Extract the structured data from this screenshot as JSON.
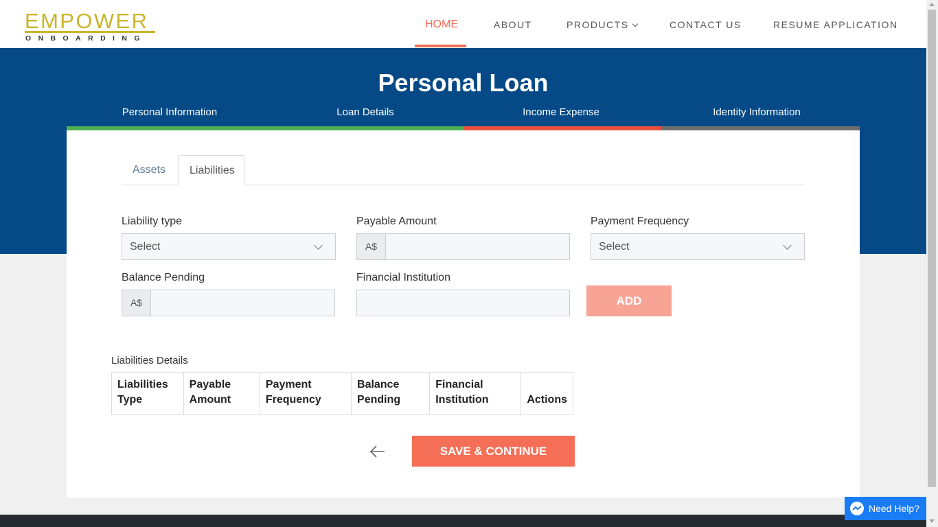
{
  "header": {
    "logo_main": "EMPOWER",
    "logo_sub": "ONBOARDING",
    "nav": [
      "HOME",
      "ABOUT",
      "PRODUCTS",
      "CONTACT US",
      "RESUME APPLICATION"
    ],
    "active_nav": "HOME"
  },
  "page": {
    "title": "Personal Loan",
    "steps": [
      "Personal Information",
      "Loan Details",
      "Income Expense",
      "Identity Information"
    ]
  },
  "tabs": {
    "assets": "Assets",
    "liabilities": "Liabilities",
    "active": "Liabilities"
  },
  "form": {
    "liability_type": {
      "label": "Liability type",
      "selected": "Select"
    },
    "payable_amount": {
      "label": "Payable Amount",
      "currency": "A$",
      "value": ""
    },
    "payment_frequency": {
      "label": "Payment Frequency",
      "selected": "Select"
    },
    "balance_pending": {
      "label": "Balance Pending",
      "currency": "A$",
      "value": ""
    },
    "financial_institution": {
      "label": "Financial Institution",
      "value": ""
    },
    "add_label": "ADD"
  },
  "table": {
    "caption": "Liabilities Details",
    "headers": [
      [
        "Liabilities",
        "Type"
      ],
      [
        "Payable",
        "Amount"
      ],
      [
        "Payment",
        "Frequency"
      ],
      [
        "Balance",
        "Pending"
      ],
      [
        "Financial",
        "Institution"
      ],
      [
        "",
        "Actions"
      ]
    ],
    "rows": []
  },
  "footer_actions": {
    "save_label": "SAVE & CONTINUE"
  },
  "help": {
    "label": "Need Help?"
  },
  "colors": {
    "accent": "#f56f57",
    "banner": "#054a86",
    "step_done": "#4caf50",
    "step_current": "#ea4f3d",
    "step_pending": "#6e6e6e",
    "logo": "#c9b52a"
  }
}
